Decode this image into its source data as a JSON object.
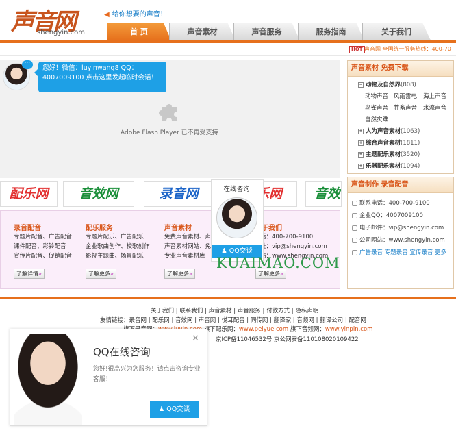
{
  "header": {
    "logo_text": "声音网",
    "logo_domain": "shengyin.com",
    "slogan": "给你想要的声音！",
    "slogan_icon": "arrow-left-icon",
    "tabs": [
      {
        "label": "首 页",
        "active": true
      },
      {
        "label": "声音素材",
        "active": false
      },
      {
        "label": "声音服务",
        "active": false
      },
      {
        "label": "服务指南",
        "active": false
      },
      {
        "label": "关于我们",
        "active": false
      }
    ],
    "hot_badge": "HOT",
    "hotline": "声音网 全国统一服务热线：400-70"
  },
  "chat": {
    "message": "您好！微信：luyinwang8 QQ：4007009100 点击这里发起临时会话！"
  },
  "flash": {
    "text": "Adobe Flash Player 已不再受支持"
  },
  "sidebar": {
    "materials": {
      "title": "声音素材 免费下载",
      "tree": [
        {
          "label": "动物及自然界",
          "count": "(808)",
          "expanded": true,
          "children": [
            "动物声音",
            "风雨雷电",
            "海上声音",
            "鸟雀声音",
            "牲畜声音",
            "水流声音",
            "自然灾难"
          ]
        },
        {
          "label": "人为声音素材",
          "count": "(1063)",
          "expanded": false
        },
        {
          "label": "综合声音素材",
          "count": "(1811)",
          "expanded": false
        },
        {
          "label": "主题配乐素材",
          "count": "(3520)",
          "expanded": false
        },
        {
          "label": "乐器配乐素材",
          "count": "(1094)",
          "expanded": false
        }
      ]
    },
    "production": {
      "title": "声音制作 录音配音",
      "contacts": [
        {
          "label": "联系电话：400-700-9100"
        },
        {
          "label": "企业QQ：4007009100"
        },
        {
          "label": "电子邮件：vip@shengyin.com"
        },
        {
          "label": "公司网站：www.shengyin.com"
        }
      ],
      "links": "广告录音 专题录音 宣传录音 更多"
    }
  },
  "partners": [
    "配乐网",
    "音效网",
    "录音网",
    "在线咨询",
    "配乐网",
    "音效网"
  ],
  "services": [
    {
      "title": "录音配音",
      "lines": [
        "专题片配音、广告配音",
        "课件配音、彩铃配音",
        "宣传片配音、促销配音"
      ],
      "button": "了解详情"
    },
    {
      "title": "配乐服务",
      "lines": [
        "专题片配乐、广告配乐",
        "企业歌曲创作、校歌创作",
        "影视主题曲、场景配乐"
      ],
      "button": "了解更多"
    },
    {
      "title": "声音素材",
      "lines": [
        "免费声音素材、声",
        "声音素材网站、免",
        "专业声音素材库"
      ],
      "button": "了解更多"
    },
    {
      "title": "关于我们",
      "lines": [
        "话：400-700-9100",
        "址：vip@shengyin.com",
        "站：www.shengyin.com"
      ],
      "button": "了解更多"
    }
  ],
  "float_consult": {
    "title": "在线咨询",
    "button": "QQ交谈"
  },
  "watermark": "KUAIMAO.COM",
  "footer": {
    "links": "关于我们 | 联系我们 | 声音素材 | 声音服务 | 付款方式 | 隐私声明",
    "friends": "友情链接：录音网 | 配乐网 | 音效网 | 声音网 | 悦耳配音 | 同传网 | 翻译家 | 音频网 | 翻译公司 | 配音网",
    "sub_prefix": "旗下录音网：",
    "sub_luyin": "www.luyin.com",
    "sub_mid": " 旗下配乐网：",
    "sub_peiyue": "www.peiyue.com",
    "sub_mid2": " 旗下音频网：",
    "sub_yinpin": "www.yinpin.com",
    "icp": "京ICP备11046532号 京公网安备110108020109422"
  },
  "popup": {
    "title": "QQ在线咨询",
    "text": "您好!很高兴为您服务！请点击咨询专业客服！",
    "button": "QQ交谈",
    "close": "✕"
  },
  "colors": {
    "accent": "#e6701c",
    "blue": "#1ea0e6",
    "pink": "#fbeefa"
  }
}
